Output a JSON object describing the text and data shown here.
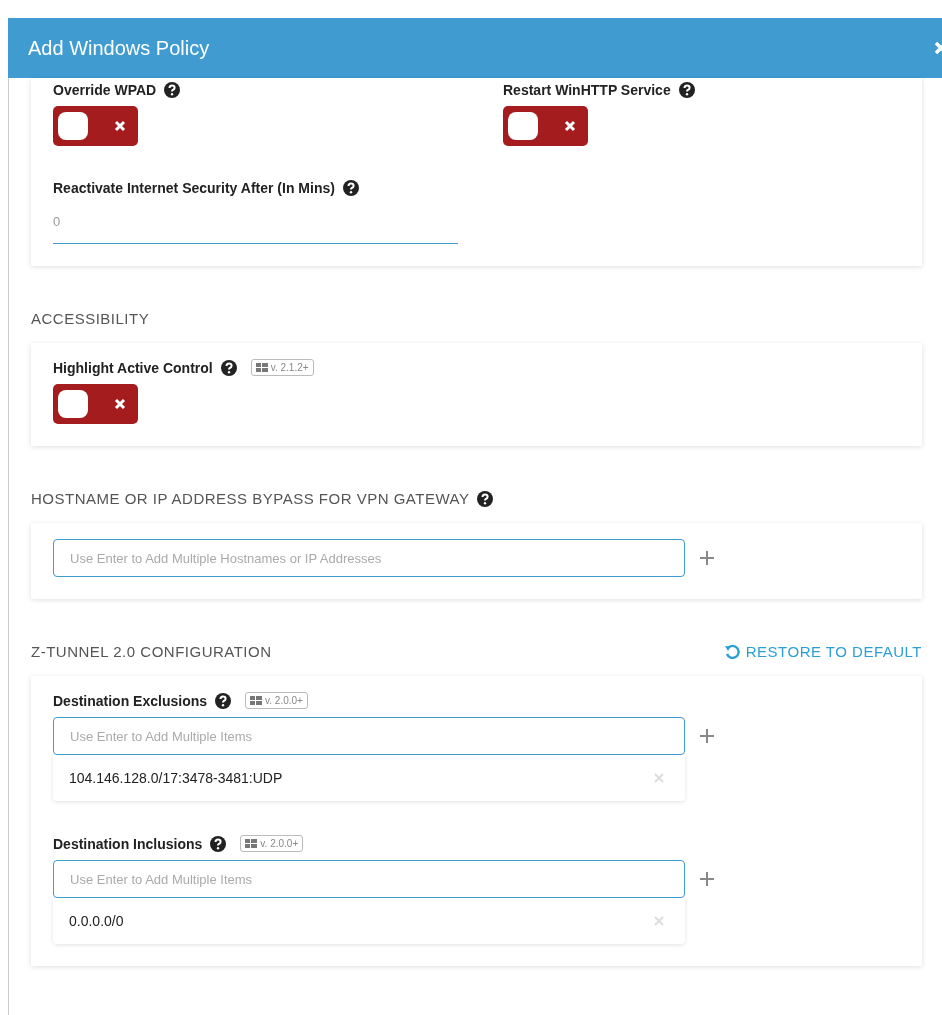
{
  "dialog": {
    "title": "Add Windows Policy"
  },
  "sections": [
    {
      "fields": [
        {
          "kind": "toggle",
          "label": "Override WPAD",
          "help": true,
          "on": false
        },
        {
          "kind": "toggle",
          "label": "Restart WinHTTP Service",
          "help": true,
          "on": false
        },
        {
          "kind": "text",
          "label": "Reactivate Internet Security After (In Mins)",
          "help": true,
          "value": "0"
        }
      ]
    },
    {
      "heading": "ACCESSIBILITY",
      "fields": [
        {
          "kind": "toggle",
          "label": "Highlight Active Control",
          "help": true,
          "version": "v. 2.1.2+",
          "on": false
        }
      ]
    },
    {
      "heading": "HOSTNAME OR IP ADDRESS BYPASS FOR VPN GATEWAY",
      "help": true,
      "fields": [
        {
          "kind": "tags",
          "placeholder": "Use Enter to Add Multiple Hostnames or IP Addresses"
        }
      ]
    },
    {
      "heading": "Z-TUNNEL 2.0 CONFIGURATION",
      "action": "RESTORE TO DEFAULT",
      "fields": [
        {
          "kind": "tags",
          "label": "Destination Exclusions",
          "help": true,
          "version": "v. 2.0.0+",
          "placeholder": "Use Enter to Add Multiple Items",
          "items": [
            "104.146.128.0/17:3478-3481:UDP"
          ]
        },
        {
          "kind": "tags",
          "label": "Destination Inclusions",
          "help": true,
          "version": "v. 2.0.0+",
          "placeholder": "Use Enter to Add Multiple Items",
          "items": [
            "0.0.0.0/0"
          ]
        }
      ]
    }
  ]
}
